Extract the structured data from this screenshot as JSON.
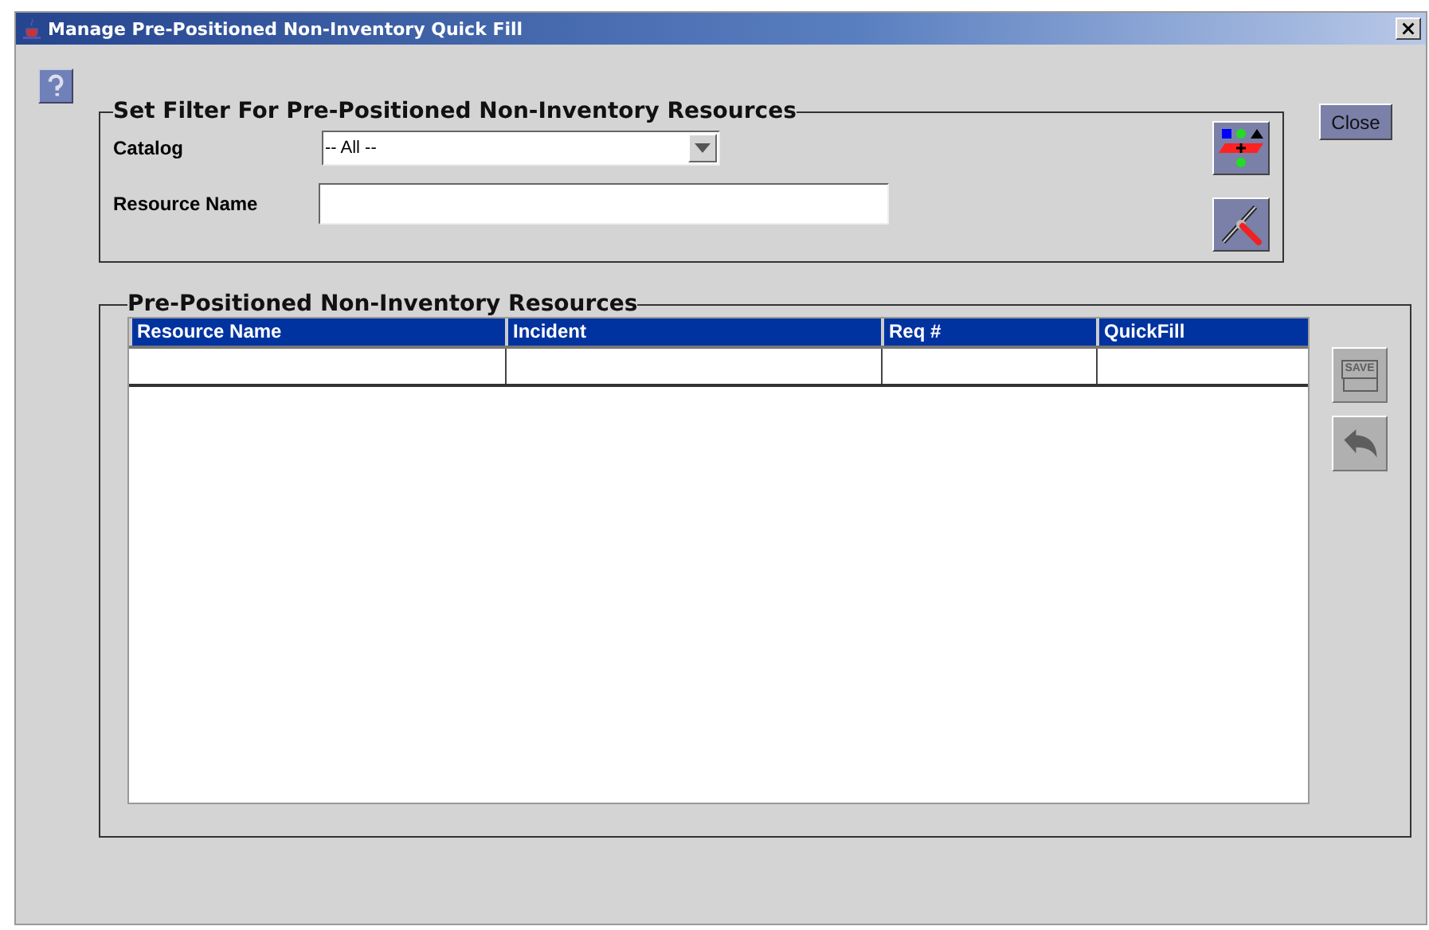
{
  "window": {
    "title": "Manage Pre-Positioned Non-Inventory Quick Fill"
  },
  "filter": {
    "title": "Set Filter For Pre-Positioned Non-Inventory Resources",
    "fields": [
      {
        "kind": "dropdown",
        "label": "Catalog",
        "value": "-- All --"
      },
      {
        "kind": "text",
        "label": "Resource Name"
      }
    ]
  },
  "close_button": {
    "label": "Close"
  },
  "table_panel": {
    "title": "Pre-Positioned Non-Inventory Resources",
    "columns": [
      "Resource Name",
      "Incident",
      "Req #",
      "QuickFill"
    ],
    "save_button": {
      "label": "SAVE",
      "disabled": true
    },
    "undo_button": {
      "disabled": true
    }
  }
}
